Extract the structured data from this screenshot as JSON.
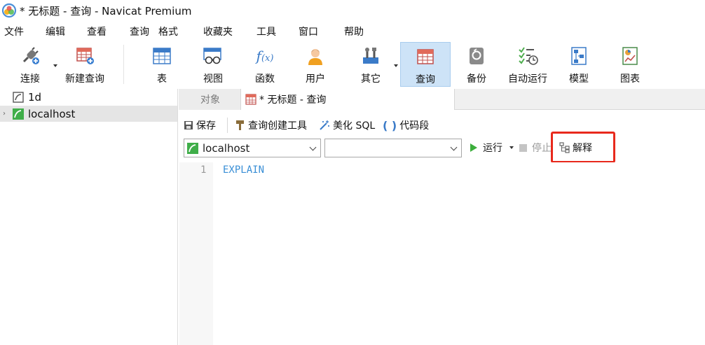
{
  "window": {
    "title": "* 无标题 - 查询 - Navicat Premium"
  },
  "menu": {
    "items": [
      "文件",
      "编辑",
      "查看",
      "查询",
      "格式",
      "收藏夹",
      "工具",
      "窗口",
      "帮助"
    ]
  },
  "toolbar": {
    "connect": "连接",
    "new_query": "新建查询",
    "table": "表",
    "view": "视图",
    "function": "函数",
    "user": "用户",
    "other": "其它",
    "query": "查询",
    "backup": "备份",
    "auto_run": "自动运行",
    "model": "模型",
    "chart": "图表"
  },
  "tree": {
    "items": [
      {
        "name": "1d"
      },
      {
        "name": "localhost",
        "expander": "›"
      }
    ]
  },
  "tabs": {
    "objects": "对象",
    "query": "* 无标题 - 查询"
  },
  "query_toolbar": {
    "save": "保存",
    "builder": "查询创建工具",
    "beautify": "美化 SQL",
    "snippet": "代码段"
  },
  "selectors": {
    "connection": "localhost",
    "database": ""
  },
  "run_bar": {
    "run": "运行",
    "stop": "停止",
    "explain": "解释"
  },
  "editor": {
    "line_number": "1",
    "code": "EXPLAIN"
  },
  "colors": {
    "accent": "#3a8fd6",
    "highlight": "#e8291c",
    "run_green": "#3cae3c",
    "active_tab": "#cde3f7"
  }
}
